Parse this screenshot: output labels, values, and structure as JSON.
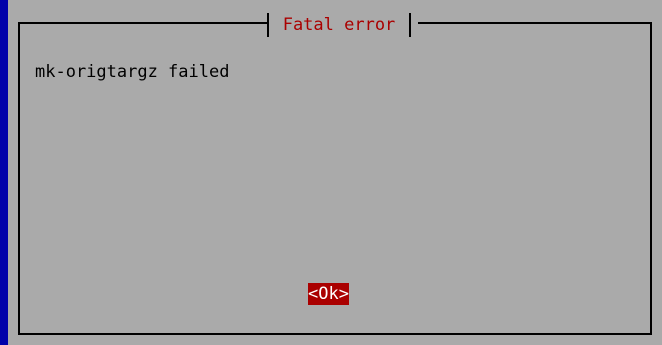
{
  "dialog": {
    "title": "Fatal error",
    "message": "mk-origtargz failed",
    "ok_label": "<Ok>"
  },
  "colors": {
    "screen_background": "#0000aa",
    "dialog_background": "#aaaaaa",
    "title_color": "#aa0000",
    "button_background": "#aa0000",
    "button_text": "#ffffff"
  }
}
